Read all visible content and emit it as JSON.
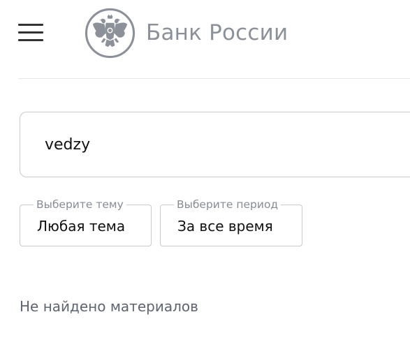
{
  "header": {
    "menu_icon": "hamburger-menu-icon",
    "logo_icon": "double-headed-eagle-emblem-icon",
    "logo_text": "Банк России"
  },
  "search": {
    "value": "vedzy"
  },
  "filters": {
    "topic": {
      "label": "Выберите тему",
      "value": "Любая тема"
    },
    "period": {
      "label": "Выберите период",
      "value": "За все время"
    }
  },
  "results": {
    "empty_message": "Не найдено материалов"
  },
  "colors": {
    "logo_gray": "#8c9199",
    "border": "#c8cace",
    "muted_text": "#5e6470"
  }
}
